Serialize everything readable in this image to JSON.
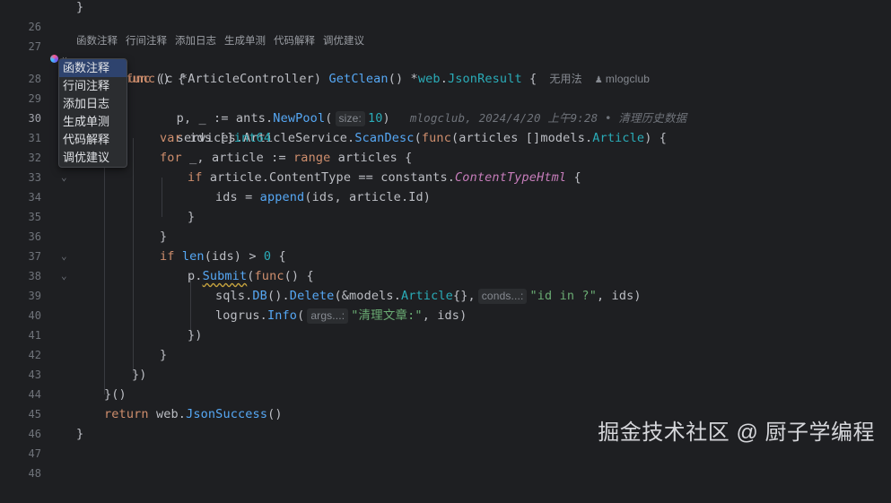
{
  "code_lens": [
    "函数注释",
    "行间注释",
    "添加日志",
    "生成单测",
    "代码解释",
    "调优建议"
  ],
  "popup_items": [
    "函数注释",
    "行间注释",
    "添加日志",
    "生成单测",
    "代码解释",
    "调优建议"
  ],
  "line_numbers": [
    "26",
    "27",
    "28",
    "29",
    "30",
    "31",
    "32",
    "33",
    "34",
    "35",
    "36",
    "37",
    "38",
    "39",
    "40",
    "41",
    "42",
    "43",
    "44",
    "45",
    "46",
    "47",
    "48"
  ],
  "current_line": "30",
  "lines": {
    "l26": {
      "brace": "}"
    },
    "l28": {
      "kw": "func",
      "p1": " (c ",
      "recv": "*ArticleController",
      "p2": ") ",
      "name": "GetClean",
      "p3": "() *",
      "pkg": "web",
      "p4": ".",
      "ret": "JsonResult",
      "p5": " {",
      "usages": "无用法",
      "author": "mlogclub"
    },
    "l29": {
      "kw": "func",
      "p1": "() {"
    },
    "l30": {
      "p1": "p, _ := ants.",
      "fn": "NewPool",
      "p2": "(",
      "hint": "size:",
      "num": "10",
      "p3": ")",
      "blame": "mlogclub, 2024/4/20 上午9:28 • 清理历史数据"
    },
    "l31": {
      "p1": "services.ArticleService.",
      "fn": "ScanDesc",
      "p2": "(",
      "kw": "func",
      "p3": "(articles []models.",
      "ty": "Article",
      "p4": ") {"
    },
    "l32": {
      "kw": "var",
      "p1": " ids []",
      "ty": "int64"
    },
    "l33": {
      "kw": "for",
      "p1": " _, article := ",
      "kw2": "range",
      "p2": " articles {"
    },
    "l34": {
      "kw": "if",
      "p1": " article.ContentType == constants.",
      "cst": "ContentTypeHtml",
      "p2": " {"
    },
    "l35": {
      "p1": "ids = ",
      "fn": "append",
      "p2": "(ids, article.Id)"
    },
    "l36": {
      "brace": "}"
    },
    "l37": {
      "brace": "}"
    },
    "l38": {
      "kw": "if",
      "p1": " ",
      "fn": "len",
      "p2": "(ids) > ",
      "num": "0",
      "p3": " {"
    },
    "l39": {
      "p1": "p.",
      "fn": "Submit",
      "p2": "(",
      "kw": "func",
      "p3": "() {"
    },
    "l40": {
      "p1": "sqls.",
      "fn": "DB",
      "p2": "().",
      "fn2": "Delete",
      "p3": "(&models.",
      "ty": "Article",
      "p4": "{},",
      "hint": "conds...:",
      "str": "\"id in ?\"",
      "p5": ", ids)"
    },
    "l41": {
      "p1": "logrus.",
      "fn": "Info",
      "p2": "(",
      "hint": "args...:",
      "str": "\"清理文章:\"",
      "p3": ", ids)"
    },
    "l42": {
      "brace": "})"
    },
    "l43": {
      "brace": "}"
    },
    "l44": {
      "brace": "})"
    },
    "l45": {
      "brace": "}()"
    },
    "l46": {
      "kw": "return",
      "p1": " web.",
      "fn": "JsonSuccess",
      "p2": "()"
    },
    "l47": {
      "brace": "}"
    }
  },
  "watermark": "掘金技术社区 @ 厨子学编程",
  "colors": {
    "background": "#1e1f22",
    "keyword": "#cf8e6d",
    "function": "#56a8f5",
    "type": "#2aacb8",
    "string": "#6aab73",
    "constant": "#c77dbb",
    "popup_selected": "#2e436e"
  },
  "icons": {
    "gutter_plugin": "ai-plugin-icon",
    "fold": "chevron-down-icon",
    "author": "user-icon"
  }
}
